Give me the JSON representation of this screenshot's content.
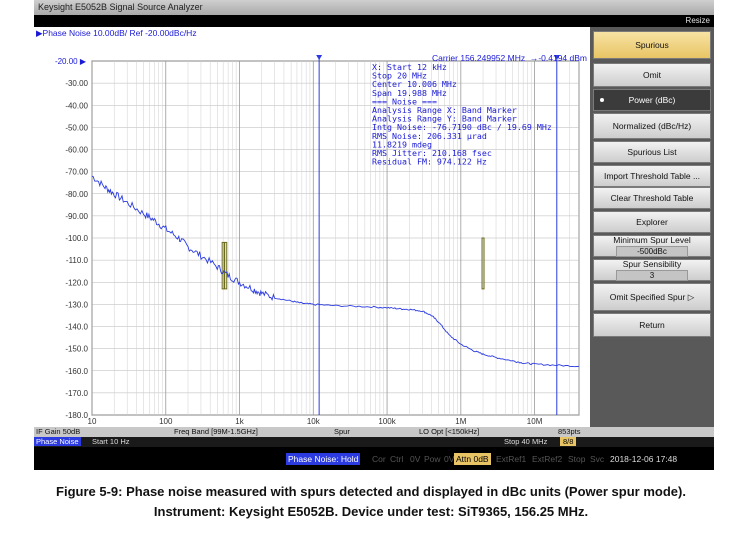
{
  "window": {
    "title": "Keysight E5052B Signal Source Analyzer",
    "resize": "Resize"
  },
  "plot": {
    "header": "▶Phase Noise 10.00dB/ Ref -20.00dBc/Hz",
    "carrier": "Carrier 156.249952 MHz",
    "marker_readout": "→-0.4194 dBm",
    "ref_marker": "-20.00 ▶",
    "y_ticks": [
      "-30.00",
      "-40.00",
      "-50.00",
      "-60.00",
      "-70.00",
      "-80.00",
      "-90.00",
      "-100.0",
      "-110.0",
      "-120.0",
      "-130.0",
      "-140.0",
      "-150.0",
      "-160.0",
      "-170.0",
      "-180.0"
    ],
    "x_ticks": [
      "10",
      "100",
      "1k",
      "10k",
      "100k",
      "1M",
      "10M"
    ],
    "annotation": [
      "X: Start 12 kHz",
      "       Stop 20 MHz",
      "     Center 10.006 MHz",
      "       Span 19.988 MHz",
      "=== Noise ===",
      "Analysis Range X: Band Marker",
      "Analysis Range Y: Band Marker",
      "Intg Noise: -76.7190 dBc / 19.69 MHz",
      "  RMS Noise: 206.331 µrad",
      "            11.8219 mdeg",
      "RMS Jitter: 210.168 fsec",
      "Residual FM: 974.122 Hz"
    ]
  },
  "chart_data": {
    "type": "line",
    "title": "Phase Noise 10.00dB/ Ref -20.00dBc/Hz",
    "xscale": "log",
    "xlim": [
      10,
      40000000
    ],
    "ylim": [
      -180,
      -20
    ],
    "x_tick_labels": [
      "10",
      "100",
      "1k",
      "10k",
      "100k",
      "1M",
      "10M"
    ],
    "y_tick_labels": [
      "-20.00",
      "-30.00",
      "-40.00",
      "-50.00",
      "-60.00",
      "-70.00",
      "-80.00",
      "-90.00",
      "-100.0",
      "-110.0",
      "-120.0",
      "-130.0",
      "-140.0",
      "-150.0",
      "-160.0",
      "-170.0",
      "-180.0"
    ],
    "grid": true,
    "series": [
      {
        "color": "#2b3be0",
        "x": [
          10,
          15,
          20,
          30,
          50,
          70,
          100,
          150,
          200,
          300,
          500,
          700,
          1000,
          1500,
          2000,
          3000,
          5000,
          7000,
          10000,
          20000,
          50000,
          100000,
          150000,
          200000,
          300000,
          400000,
          500000,
          700000,
          1000000,
          1500000,
          2000000,
          3000000,
          5000000,
          7000000,
          10000000,
          20000000,
          40000000
        ],
        "y": [
          -72,
          -77,
          -80,
          -84,
          -89,
          -92,
          -96,
          -100,
          -104,
          -108,
          -113,
          -117,
          -120,
          -123,
          -125,
          -127,
          -128.5,
          -129.5,
          -130,
          -130.6,
          -131,
          -131.5,
          -132,
          -132.3,
          -133,
          -135,
          -138,
          -144,
          -148,
          -151,
          -152.5,
          -154,
          -155.5,
          -156.5,
          -157,
          -157.5,
          -158
        ]
      }
    ],
    "spurs": [
      {
        "x": 600,
        "y": -102
      },
      {
        "x": 650,
        "y": -102
      },
      {
        "x": 2000000,
        "y": -100
      }
    ],
    "band_markers": [
      12000,
      20000000
    ]
  },
  "softkeys": [
    {
      "label": "Spurious",
      "style": "sel"
    },
    {
      "label": "Omit",
      "style": ""
    },
    {
      "label": "Power (dBc)",
      "style": "dark"
    },
    {
      "label": "Normalized (dBc/Hz)",
      "style": ""
    },
    {
      "label": "Spurious List",
      "style": ""
    },
    {
      "label": "Import Threshold Table ...",
      "style": ""
    },
    {
      "label": "Clear Threshold Table",
      "style": ""
    },
    {
      "label": "Explorer",
      "style": ""
    },
    {
      "label": "Minimum Spur Level",
      "value": "-500dBc",
      "style": ""
    },
    {
      "label": "Spur Sensibility",
      "value": "3",
      "style": ""
    },
    {
      "label": "Omit Specified Spur ▷",
      "style": ""
    },
    {
      "label": "Return",
      "style": ""
    }
  ],
  "status": {
    "if_gain": "IF Gain 50dB",
    "freq_band": "Freq Band [99M-1.5GHz]",
    "spur": "Spur",
    "lo_opt": "LO Opt [<150kHz]",
    "points": "853pts",
    "mode": "Phase Noise",
    "start": "Start 10 Hz",
    "stop": "Stop 40 MHz",
    "pages": "8/8",
    "meas_state": "Phase Noise: Hold",
    "indicators": [
      "Cor",
      "Ctrl",
      "0V",
      "Pow",
      "0V"
    ],
    "attn": "Attn 0dB",
    "ext_indicators": [
      "ExtRef1",
      "ExtRef2",
      "Stop",
      "Svc"
    ],
    "datetime": "2018-12-06 17:48"
  },
  "caption": {
    "line1": "Figure 5-9: Phase noise measured with spurs detected and displayed in dBc units (Power spur mode).",
    "line2": "Instrument: Keysight E5052B. Device under test: SiT9365, 156.25 MHz."
  },
  "colors": {
    "trace": "#2b3be0",
    "spur": "#6b6b1a",
    "marker": "#1a1ad6",
    "accent": "#e8c465"
  }
}
